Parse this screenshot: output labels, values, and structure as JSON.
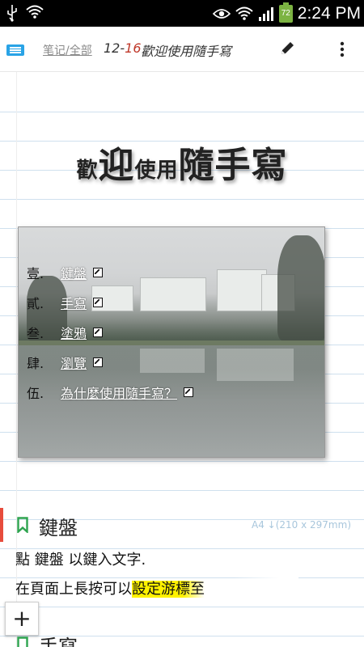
{
  "status_bar": {
    "battery_level": "72",
    "time": "2:24 PM",
    "icons": [
      "usb-icon",
      "wifi-icon",
      "eye-icon",
      "wifi-icon",
      "signal-icon",
      "battery-icon"
    ]
  },
  "app_bar": {
    "breadcrumb": "笔记/全部",
    "date_month": "12-",
    "date_day": "16",
    "title": "歡迎使用隨手寫",
    "icons": [
      "menu-icon",
      "pencil-icon",
      "more-vertical-icon"
    ]
  },
  "welcome": {
    "part1": "歡",
    "part2": "迎",
    "part3": "使用",
    "part4": "隨手寫"
  },
  "toc": {
    "items": [
      {
        "num": "壹.",
        "label": "鍵盤"
      },
      {
        "num": "貳.",
        "label": "手寫"
      },
      {
        "num": "叁.",
        "label": "塗鴉"
      },
      {
        "num": "肆.",
        "label": "瀏覽"
      },
      {
        "num": "伍.",
        "label": "為什麼使用隨手寫？"
      }
    ]
  },
  "section": {
    "title": "鍵盤",
    "page_size": "A4 ↓(210 x 297mm)",
    "line1": "點 鍵盤 以鍵入文字.",
    "line2_plain": "在頁面上長按可以",
    "line2_highlight": "設定游標至"
  },
  "next_section": {
    "title": "手寫"
  },
  "fab": {
    "label": "+"
  },
  "colors": {
    "accent_blue": "#29a3e6",
    "bookmark_green": "#2ea44f",
    "date_red": "#c0392b",
    "highlight_yellow": "#fff200",
    "section_bar_red": "#e74c3c",
    "ruled_line": "#cfe0ee"
  }
}
